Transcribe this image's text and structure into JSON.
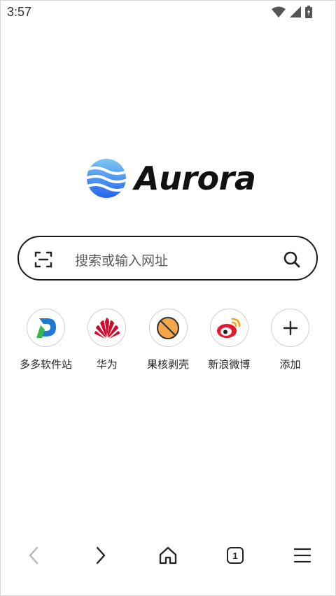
{
  "status_bar": {
    "time": "3:57"
  },
  "brand": {
    "name": "Aurora"
  },
  "search": {
    "placeholder": "搜索或输入网址"
  },
  "shortcuts": [
    {
      "label": "多多软件站",
      "icon": "duoduo-logo-icon"
    },
    {
      "label": "华为",
      "icon": "huawei-logo-icon"
    },
    {
      "label": "果核剥壳",
      "icon": "guohe-logo-icon"
    },
    {
      "label": "新浪微博",
      "icon": "weibo-logo-icon"
    },
    {
      "label": "添加",
      "icon": "plus-icon"
    }
  ],
  "toolbar": {
    "tab_count": "1"
  },
  "colors": {
    "accent": "#3b82f6",
    "weibo_red": "#e6162d",
    "huawei_red": "#cf0a2c",
    "guohe_orange": "#f5a54a"
  }
}
